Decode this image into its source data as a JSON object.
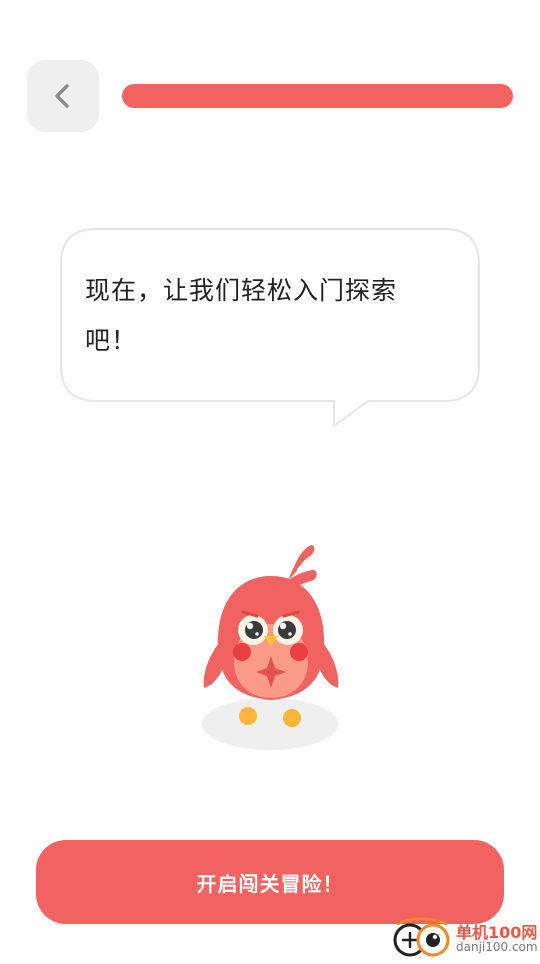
{
  "progress": {
    "value": 1.0
  },
  "bubble": {
    "text": "现在，让我们轻松入门探索吧！"
  },
  "start_button": {
    "label": "开启闯关冒险！"
  },
  "watermark": {
    "name": "单机100网",
    "url": "danji100.com"
  },
  "colors": {
    "accent": "#f06360",
    "back_button_bg": "#efefef",
    "bubble_border": "#e6e6e6",
    "text": "#222222"
  },
  "icons": {
    "back": "chevron-left-icon",
    "mascot": "red-bird-mascot"
  }
}
